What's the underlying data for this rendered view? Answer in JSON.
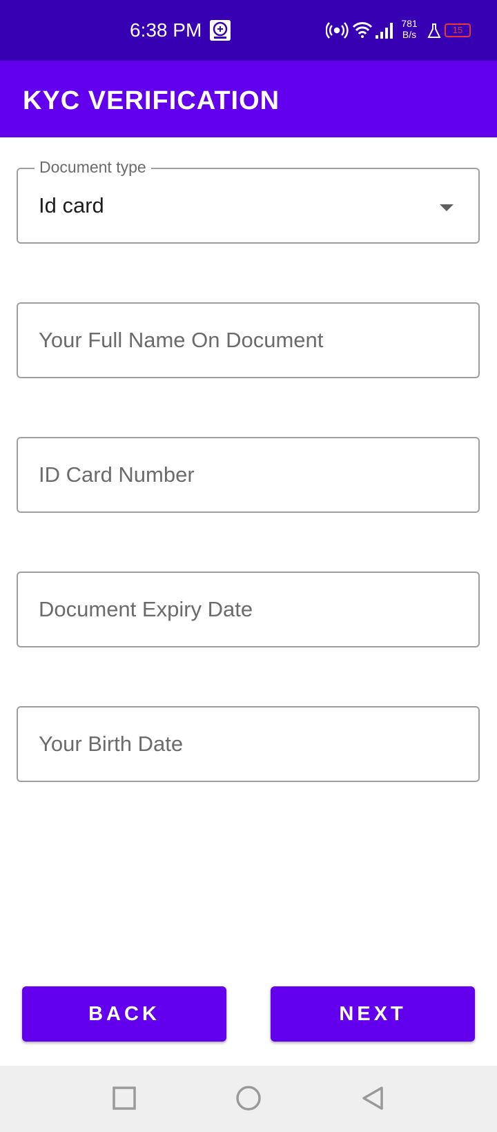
{
  "status_bar": {
    "time": "6:38 PM",
    "network_speed_value": "781",
    "network_speed_unit": "B/s",
    "battery_level": "15",
    "icons": [
      "app-notification-icon",
      "hotspot-icon",
      "wifi-icon",
      "signal-icon",
      "lab-icon",
      "battery-icon"
    ],
    "battery_color": "#e53935"
  },
  "app_bar": {
    "title": "KYC VERIFICATION",
    "color": "#6200ee",
    "status_color": "#3700b3"
  },
  "form": {
    "document_type": {
      "label": "Document type",
      "value": "Id card"
    },
    "full_name": {
      "placeholder": "Your Full Name On Document"
    },
    "id_card_number": {
      "placeholder": "ID Card Number"
    },
    "expiry_date": {
      "placeholder": "Document Expiry Date"
    },
    "birth_date": {
      "placeholder": "Your Birth Date"
    }
  },
  "buttons": {
    "back": "BACK",
    "next": "NEXT"
  },
  "nav_bar": {
    "icons": [
      "recent-apps-icon",
      "home-icon",
      "back-icon"
    ]
  }
}
